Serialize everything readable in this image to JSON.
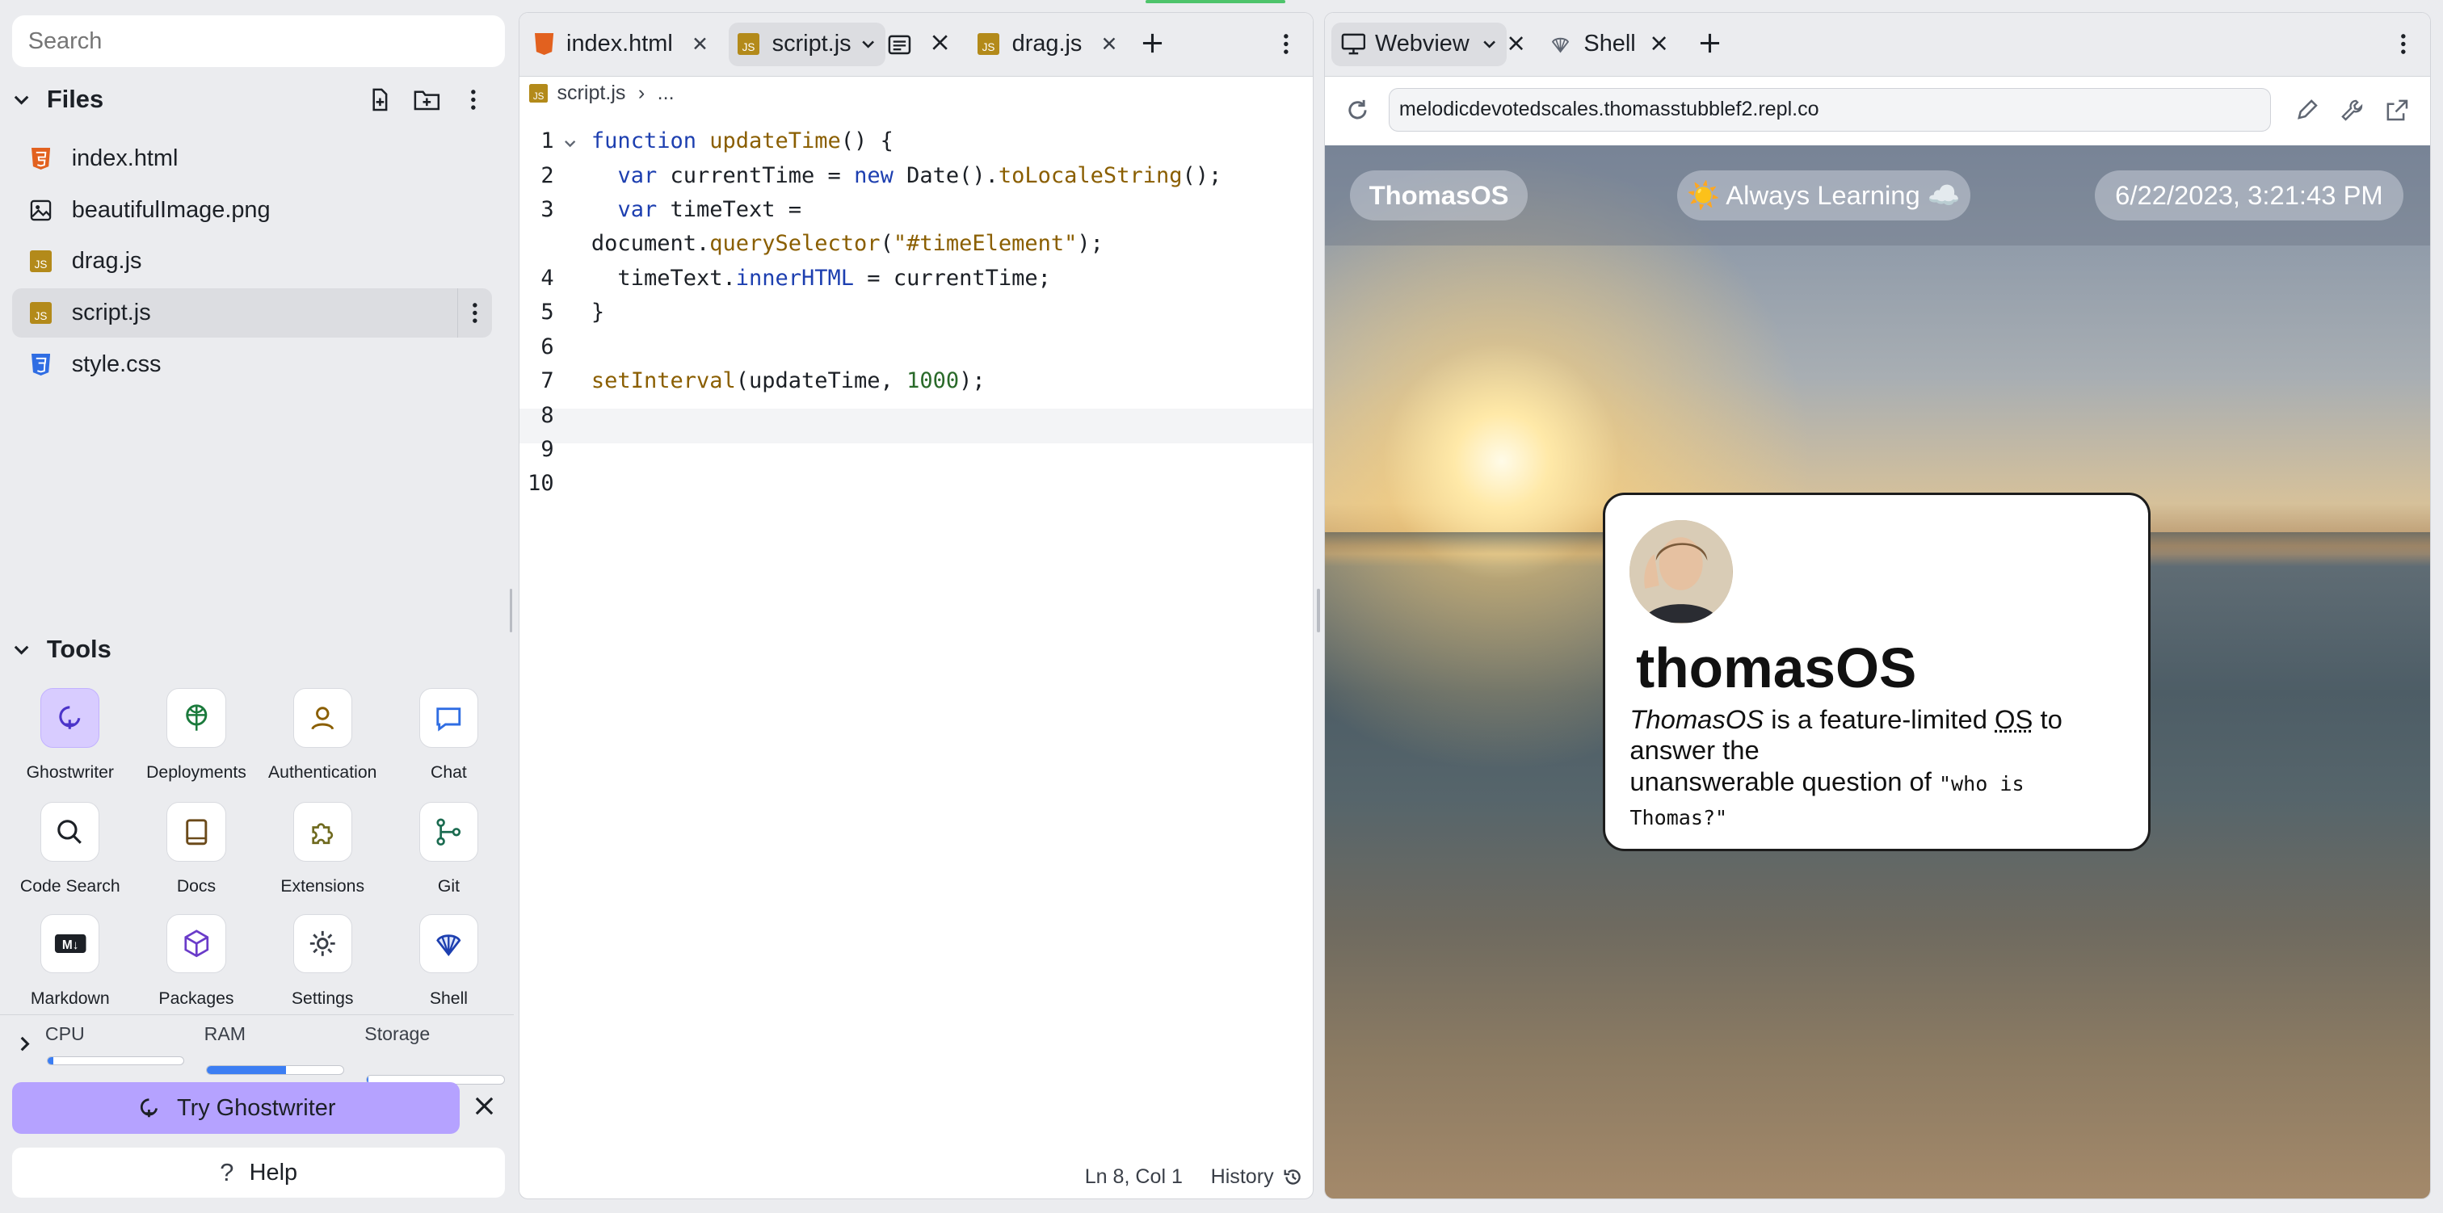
{
  "sidebar": {
    "search_placeholder": "Search",
    "files_title": "Files",
    "files": [
      {
        "name": "index.html",
        "icon": "html-file-icon"
      },
      {
        "name": "beautifulImage.png",
        "icon": "image-file-icon"
      },
      {
        "name": "drag.js",
        "icon": "js-file-icon"
      },
      {
        "name": "script.js",
        "icon": "js-file-icon",
        "active": true
      },
      {
        "name": "style.css",
        "icon": "css-file-icon"
      }
    ],
    "tools_title": "Tools",
    "tools": [
      {
        "label": "Ghostwriter",
        "icon": "ghostwriter-icon"
      },
      {
        "label": "Deployments",
        "icon": "deployments-icon"
      },
      {
        "label": "Authentication",
        "icon": "user-icon"
      },
      {
        "label": "Chat",
        "icon": "chat-icon"
      },
      {
        "label": "Code Search",
        "icon": "search-icon"
      },
      {
        "label": "Docs",
        "icon": "book-icon"
      },
      {
        "label": "Extensions",
        "icon": "puzzle-icon"
      },
      {
        "label": "Git",
        "icon": "git-icon"
      },
      {
        "label": "Markdown",
        "icon": "markdown-icon"
      },
      {
        "label": "Packages",
        "icon": "package-icon"
      },
      {
        "label": "Settings",
        "icon": "gear-icon"
      },
      {
        "label": "Shell",
        "icon": "shell-icon"
      }
    ],
    "resources": {
      "cpu_label": "CPU",
      "cpu_fraction": 0.04,
      "ram_label": "RAM",
      "ram_fraction": 0.58,
      "storage_label": "Storage",
      "storage_fraction": 0.01
    },
    "try_label": "Try Ghostwriter",
    "help_label": "Help"
  },
  "editor": {
    "tabs": [
      {
        "label": "index.html"
      },
      {
        "label": "script.js",
        "active": true
      },
      {
        "label": "drag.js"
      }
    ],
    "breadcrumb_file": "script.js",
    "breadcrumb_more": "...",
    "line_numbers": [
      "1",
      "2",
      "3",
      "",
      "4",
      "5",
      "6",
      "7",
      "8",
      "9",
      "10"
    ],
    "status_position": "Ln 8, Col 1",
    "history_label": "History"
  },
  "webview": {
    "tab_label": "Webview",
    "shell_tab_label": "Shell",
    "url": "melodicdevotedscales.thomasstubblef2.repl.co",
    "page": {
      "brand": "ThomasOS",
      "motto": "☀️ Always Learning ☁️",
      "datetime": "6/22/2023, 3:21:43 PM",
      "card_title": "thomasOS",
      "desc_em": "ThomasOS",
      "desc_1": " is a feature-limited ",
      "desc_abbr": "OS",
      "desc_2": " to answer the",
      "desc_3": "unanswerable question of ",
      "desc_code": "\"who is Thomas?\""
    }
  }
}
